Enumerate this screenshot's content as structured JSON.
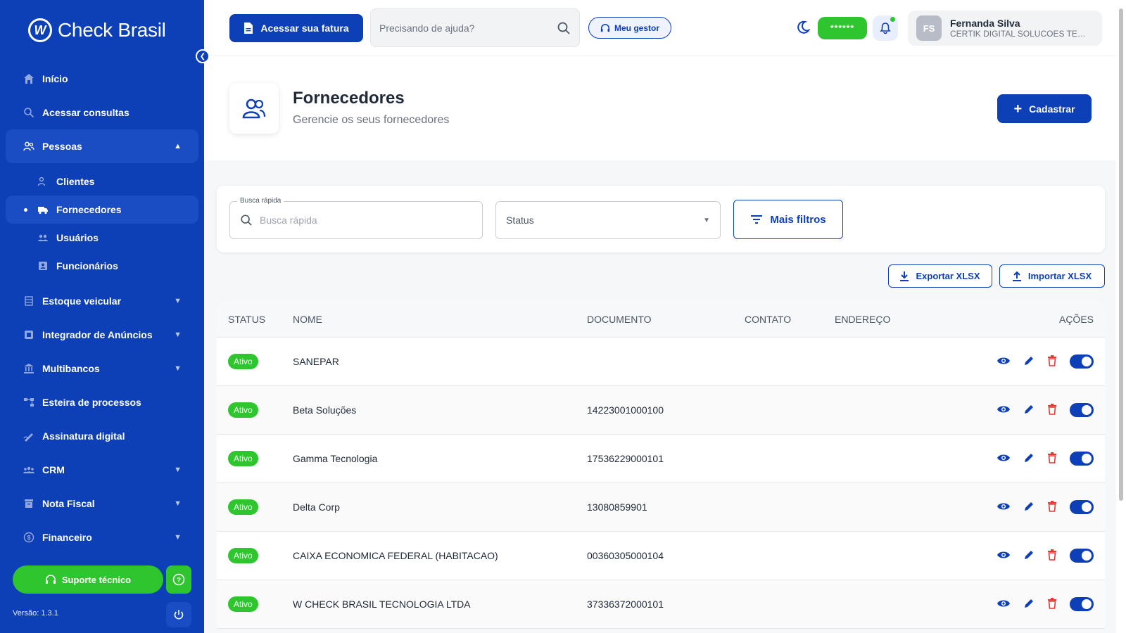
{
  "brand": {
    "name": "Check Brasil"
  },
  "sidebar": {
    "items": [
      {
        "label": "Início",
        "icon": "home-icon"
      },
      {
        "label": "Acessar consultas",
        "icon": "search-icon"
      },
      {
        "label": "Pessoas",
        "icon": "people-icon",
        "expanded": true
      },
      {
        "label": "Estoque veicular",
        "icon": "stock-icon"
      },
      {
        "label": "Integrador de Anúncios",
        "icon": "ads-icon"
      },
      {
        "label": "Multibancos",
        "icon": "bank-icon"
      },
      {
        "label": "Esteira de processos",
        "icon": "process-icon"
      },
      {
        "label": "Assinatura digital",
        "icon": "signature-icon"
      },
      {
        "label": "CRM",
        "icon": "crm-icon"
      },
      {
        "label": "Nota Fiscal",
        "icon": "invoice-icon"
      },
      {
        "label": "Financeiro",
        "icon": "finance-icon"
      }
    ],
    "sub_items": [
      {
        "label": "Clientes",
        "icon": "clients-icon"
      },
      {
        "label": "Fornecedores",
        "icon": "truck-icon",
        "active": true
      },
      {
        "label": "Usuários",
        "icon": "users-icon"
      },
      {
        "label": "Funcionários",
        "icon": "badge-icon"
      }
    ],
    "support_label": "Suporte técnico",
    "version": "Versão: 1.3.1"
  },
  "topbar": {
    "invoice_button": "Acessar sua fatura",
    "help_placeholder": "Precisando de ajuda?",
    "manager_button": "Meu gestor",
    "masked_value": "******",
    "user": {
      "initials": "FS",
      "name": "Fernanda Silva",
      "company": "CERTIK DIGITAL SOLUCOES TECNOLOGICAS"
    }
  },
  "page": {
    "title": "Fornecedores",
    "subtitle": "Gerencie os seus fornecedores",
    "create_button": "Cadastrar"
  },
  "filters": {
    "quick_search_legend": "Busca rápida",
    "quick_search_placeholder": "Busca rápida",
    "status_label": "Status",
    "more_filters": "Mais filtros",
    "export_button": "Exportar XLSX",
    "import_button": "Importar XLSX"
  },
  "table": {
    "columns": [
      "STATUS",
      "NOME",
      "DOCUMENTO",
      "CONTATO",
      "ENDEREÇO",
      "AÇÕES"
    ],
    "rows": [
      {
        "status": "Ativo",
        "nome": "SANEPAR",
        "documento": "",
        "contato": "",
        "endereco": ""
      },
      {
        "status": "Ativo",
        "nome": "Beta Soluções",
        "documento": "14223001000100",
        "contato": "",
        "endereco": ""
      },
      {
        "status": "Ativo",
        "nome": "Gamma Tecnologia",
        "documento": "17536229000101",
        "contato": "",
        "endereco": ""
      },
      {
        "status": "Ativo",
        "nome": "Delta Corp",
        "documento": "13080859901",
        "contato": "",
        "endereco": ""
      },
      {
        "status": "Ativo",
        "nome": "CAIXA ECONOMICA FEDERAL (HABITACAO)",
        "documento": "00360305000104",
        "contato": "",
        "endereco": ""
      },
      {
        "status": "Ativo",
        "nome": "W CHECK BRASIL TECNOLOGIA LTDA",
        "documento": "37336372000101",
        "contato": "",
        "endereco": ""
      }
    ]
  },
  "colors": {
    "primary": "#0d3fb7",
    "success": "#2fc52f",
    "danger": "#e53935"
  }
}
